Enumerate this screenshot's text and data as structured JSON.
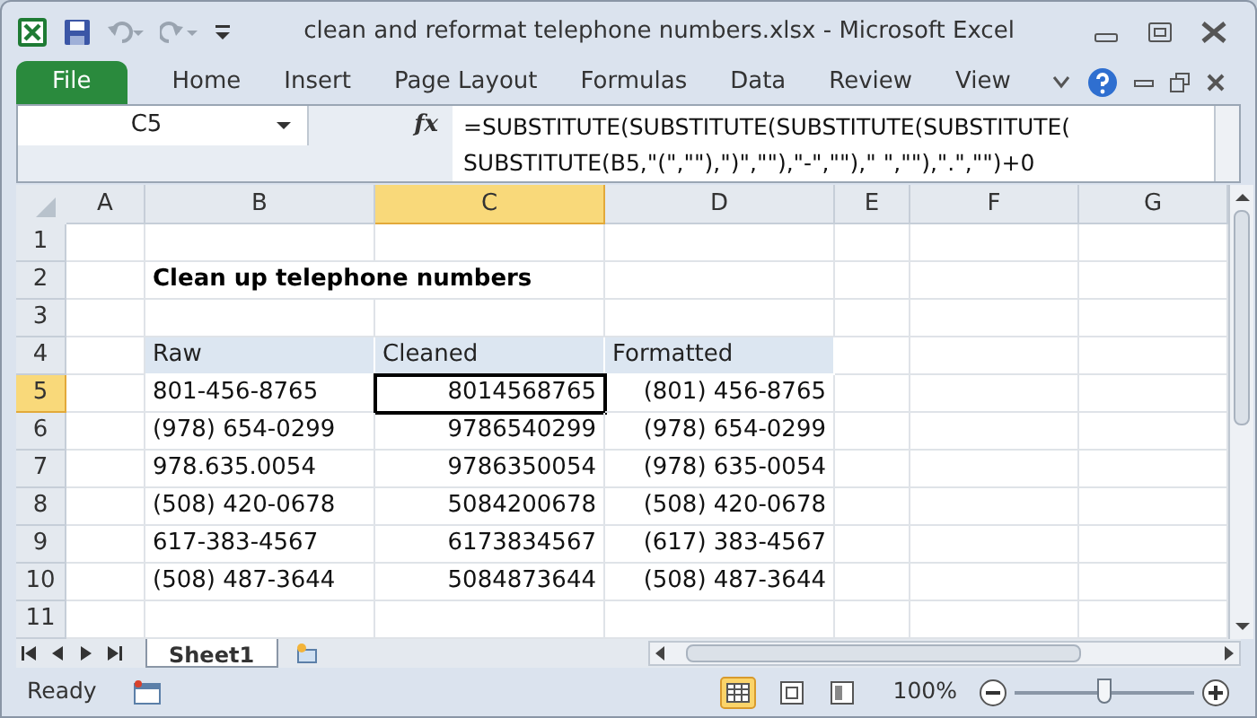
{
  "window": {
    "title": "clean and reformat telephone numbers.xlsx  -  Microsoft Excel"
  },
  "ribbon_tabs": [
    {
      "label": "File",
      "selected": true
    },
    {
      "label": "Home",
      "selected": false
    },
    {
      "label": "Insert",
      "selected": false
    },
    {
      "label": "Page Layout",
      "selected": false
    },
    {
      "label": "Formulas",
      "selected": false
    },
    {
      "label": "Data",
      "selected": false
    },
    {
      "label": "Review",
      "selected": false
    },
    {
      "label": "View",
      "selected": false
    }
  ],
  "formula_bar": {
    "name_box": "C5",
    "fx": "fx",
    "formula_lines": [
      "=SUBSTITUTE(SUBSTITUTE(SUBSTITUTE(SUBSTITUTE(",
      "SUBSTITUTE(B5,\"(\",\"\"),\")\",\"\"),\"-\",\"\"),\" \",\"\"),\".\",\"\")+0"
    ]
  },
  "column_headers": [
    {
      "label": "A",
      "selected": false
    },
    {
      "label": "B",
      "selected": false
    },
    {
      "label": "C",
      "selected": true
    },
    {
      "label": "D",
      "selected": false
    },
    {
      "label": "E",
      "selected": false
    },
    {
      "label": "F",
      "selected": false
    },
    {
      "label": "G",
      "selected": false
    }
  ],
  "row_headers": [
    {
      "label": "1",
      "selected": false
    },
    {
      "label": "2",
      "selected": false
    },
    {
      "label": "3",
      "selected": false
    },
    {
      "label": "4",
      "selected": false
    },
    {
      "label": "5",
      "selected": true
    },
    {
      "label": "6",
      "selected": false
    },
    {
      "label": "7",
      "selected": false
    },
    {
      "label": "8",
      "selected": false
    },
    {
      "label": "9",
      "selected": false
    },
    {
      "label": "10",
      "selected": false
    },
    {
      "label": "11",
      "selected": false
    }
  ],
  "sheet": {
    "title": "Clean up telephone numbers",
    "table_columns": [
      "Raw",
      "Cleaned",
      "Formatted"
    ],
    "rows": [
      {
        "cells": [
          {
            "text": "801-456-8765",
            "selected": false
          },
          {
            "text": "8014568765",
            "selected": true
          },
          {
            "text": "(801) 456-8765",
            "selected": false
          }
        ]
      },
      {
        "cells": [
          {
            "text": "(978) 654-0299",
            "selected": false
          },
          {
            "text": "9786540299",
            "selected": false
          },
          {
            "text": "(978) 654-0299",
            "selected": false
          }
        ]
      },
      {
        "cells": [
          {
            "text": "978.635.0054",
            "selected": false
          },
          {
            "text": "9786350054",
            "selected": false
          },
          {
            "text": "(978) 635-0054",
            "selected": false
          }
        ]
      },
      {
        "cells": [
          {
            "text": "(508) 420-0678",
            "selected": false
          },
          {
            "text": "5084200678",
            "selected": false
          },
          {
            "text": "(508) 420-0678",
            "selected": false
          }
        ]
      },
      {
        "cells": [
          {
            "text": "617-383-4567",
            "selected": false
          },
          {
            "text": "6173834567",
            "selected": false
          },
          {
            "text": "(617) 383-4567",
            "selected": false
          }
        ]
      },
      {
        "cells": [
          {
            "text": "(508) 487-3644",
            "selected": false
          },
          {
            "text": "5084873644",
            "selected": false
          },
          {
            "text": "(508) 487-3644",
            "selected": false
          }
        ]
      }
    ]
  },
  "sheet_tabs": [
    {
      "label": "Sheet1",
      "selected": true
    }
  ],
  "status_bar": {
    "status": "Ready",
    "zoom": "100%",
    "zoom_slider": {
      "level": 0.5
    }
  }
}
